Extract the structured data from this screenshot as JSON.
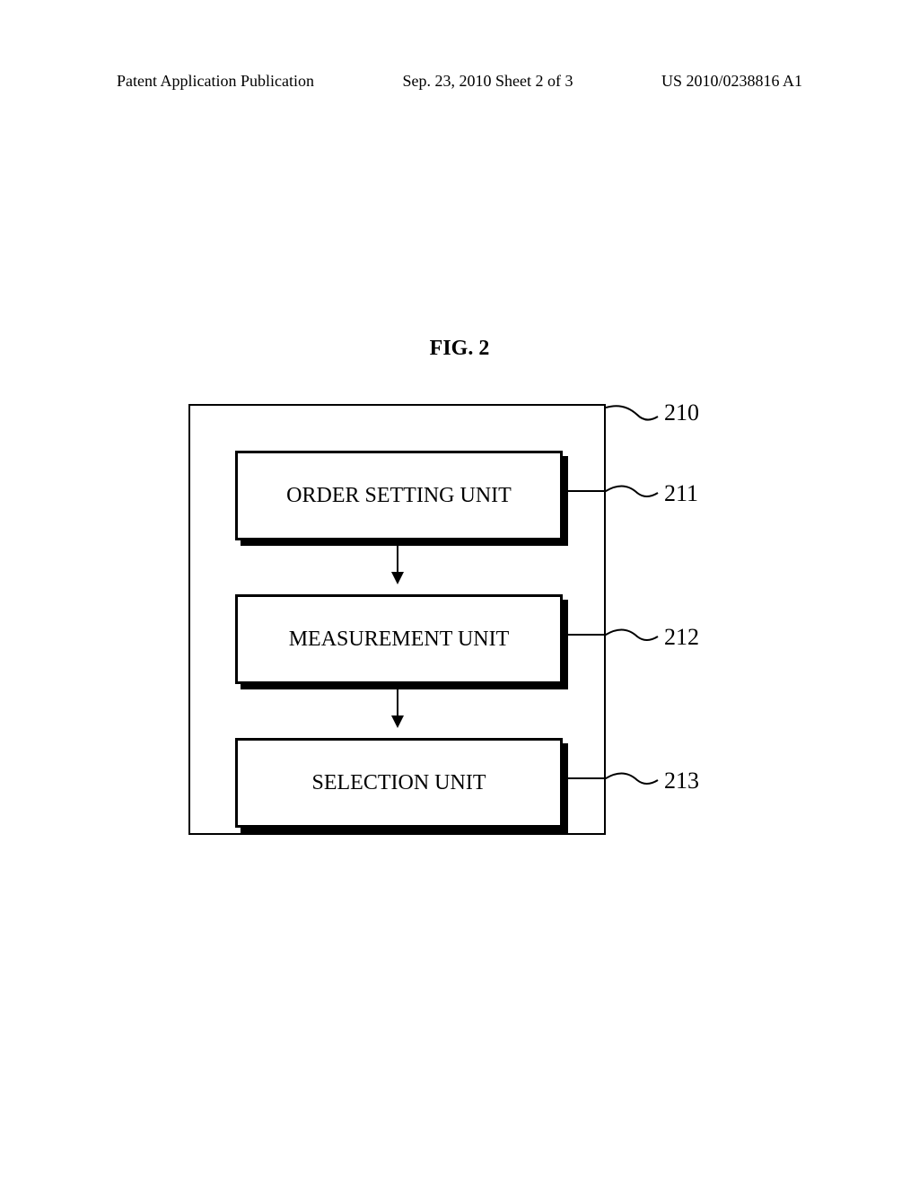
{
  "header": {
    "left": "Patent Application Publication",
    "center": "Sep. 23, 2010  Sheet 2 of 3",
    "right": "US 2010/0238816 A1"
  },
  "figure": {
    "title": "FIG. 2",
    "boxes": {
      "box1": "ORDER SETTING UNIT",
      "box2": "MEASUREMENT UNIT",
      "box3": "SELECTION UNIT"
    },
    "refs": {
      "ref210": "210",
      "ref211": "211",
      "ref212": "212",
      "ref213": "213"
    }
  }
}
